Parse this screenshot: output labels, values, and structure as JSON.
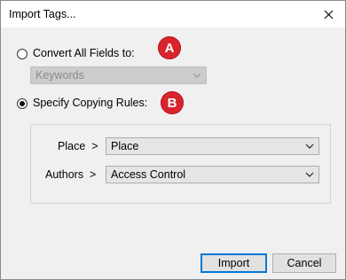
{
  "window": {
    "title": "Import Tags..."
  },
  "option_convert": {
    "label": "Convert All Fields to:",
    "badge": "A",
    "selected": false,
    "dropdown_value": "Keywords"
  },
  "option_specify": {
    "label": "Specify Copying Rules:",
    "badge": "B",
    "selected": true
  },
  "rules": [
    {
      "label": "Place",
      "separator": ">",
      "value": "Place"
    },
    {
      "label": "Authors",
      "separator": ">",
      "value": "Access Control"
    }
  ],
  "buttons": {
    "import": "Import",
    "cancel": "Cancel"
  },
  "colors": {
    "badge": "#d8242d",
    "accent": "#0078d7"
  },
  "icons": {
    "close": "close-icon",
    "dropdown": "chevron-down-icon"
  }
}
